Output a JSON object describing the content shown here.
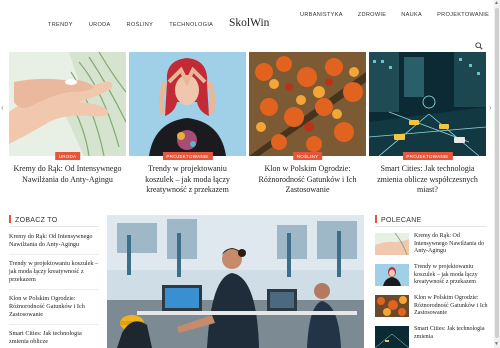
{
  "header": {
    "nav_left": [
      "TRENDY",
      "URODA",
      "ROŚLINY",
      "TECHNOLOGIA"
    ],
    "logo": "SkolWin",
    "nav_right": [
      "URBANISTYKA",
      "ZDROWIE",
      "NAUKA",
      "PROJEKTOWANIE"
    ]
  },
  "carousel": {
    "cards": [
      {
        "badge": "URODA",
        "title": "Kremy do Rąk: Od Intensywnego Nawilżania do Anty-Agingu"
      },
      {
        "badge": "PROJEKTOWANIE",
        "title": "Trendy w projektowaniu koszulek – jak moda łączy kreatywność z przekazem"
      },
      {
        "badge": "ROŚLINY",
        "title": "Klon w Polskim Ogrodzie: Różnorodność Gatunków i Ich Zastosowanie"
      },
      {
        "badge": "PROJEKTOWANIE",
        "title": "Smart Cities: Jak technologia zmienia oblicze współczesnych miast?"
      }
    ],
    "accent": "#e6553a"
  },
  "left_section": {
    "heading": "ZOBACZ TO",
    "items": [
      "Kremy do Rąk: Od Intensywnego Nawilżania do Anty-Agingu",
      "Trendy w projektowaniu koszulek – jak moda łączy kreatywność z przekazem",
      "Klon w Polskim Ogrodzie: Różnorodność Gatunków i Ich Zastosowanie",
      "Smart Cities: Jak technologia zmienia oblicze"
    ]
  },
  "right_section": {
    "heading": "POLECANE",
    "items": [
      "Kremy do Rąk: Od Intensywnego Nawilżania do Anty-Agingu",
      "Trendy w projektowaniu koszulek – jak moda łączy kreatywność z przekazem",
      "Klon w Polskim Ogrodzie: Różnorodność Gatunków i Ich Zastosowanie",
      "Smart Cities: Jak technologia zmienia"
    ]
  },
  "icons": {
    "search": "search-icon",
    "carousel_prev": "chevron-left-icon",
    "carousel_next": "chevron-right-icon"
  }
}
